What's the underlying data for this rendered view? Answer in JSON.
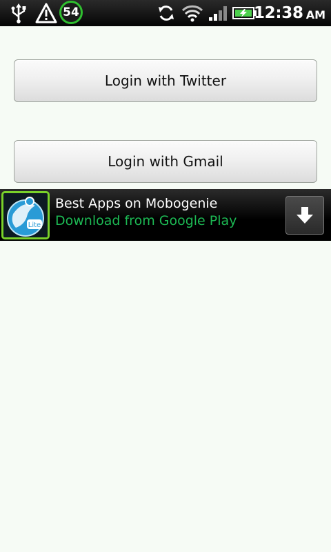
{
  "status_bar": {
    "icons": [
      "usb-icon",
      "warning-icon",
      "sync-icon",
      "wifi-icon",
      "signal-icon",
      "battery-charging-icon"
    ],
    "battery_level": "54",
    "time": "12:38",
    "ampm": "AM",
    "colors": {
      "battery_ring": "#2fbf2f",
      "charging": "#4cd04c"
    }
  },
  "buttons": {
    "twitter_label": "Login with Twitter",
    "gmail_label": "Login with Gmail"
  },
  "ad": {
    "logo_icon": "mobogenie-lite-logo",
    "logo_text": "Lite",
    "title": "Best Apps on Mobogenie",
    "subtitle": "Download from Google Play",
    "download_icon": "download-arrow-icon",
    "colors": {
      "subtitle": "#1db954",
      "logo_border": "#7ad12a"
    }
  }
}
